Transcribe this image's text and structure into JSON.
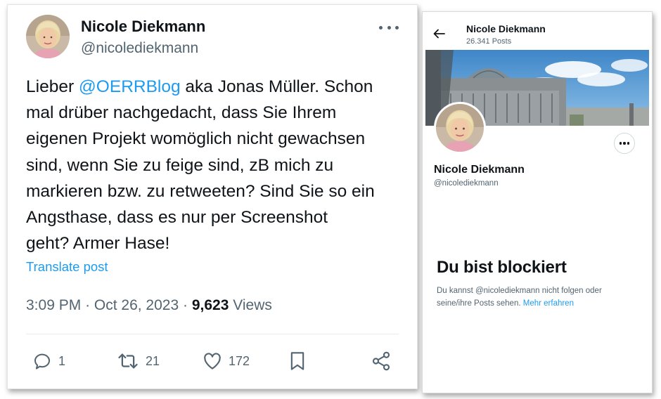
{
  "tweet": {
    "author_name": "Nicole Diekmann",
    "author_handle": "@nicolediekmann",
    "more_icon": "more-horizontal-icon",
    "text": {
      "line1_before": "Lieber ",
      "mention": "@OERRBlog",
      "line1_after": " aka Jonas Müller. Schon",
      "line2": "mal drüber nachgedacht, dass Sie Ihrem",
      "line3": "eigenen Projekt womöglich nicht gewachsen",
      "line4": "sind, wenn Sie zu feige sind, zB mich zu",
      "line5": "markieren bzw. zu retweeten? Sind Sie so ein",
      "line6": "Angsthase, dass es nur per Screenshot",
      "line7": "geht? Armer Hase!"
    },
    "translate_label": "Translate post",
    "time": "3:09 PM",
    "separator": "·",
    "date": "Oct 26, 2023",
    "views_count": "9,623",
    "views_label": "Views",
    "actions": {
      "replies": "1",
      "retweets": "21",
      "likes": "172"
    }
  },
  "profile": {
    "header_name": "Nicole Diekmann",
    "header_posts": "26.341 Posts",
    "name": "Nicole Diekmann",
    "handle": "@nicolediekmann",
    "blocked_title": "Du bist blockiert",
    "blocked_line1": "Du kannst @nicolediekmann nicht folgen oder",
    "blocked_line2_text": "seine/ihre Posts sehen.",
    "learn_more": "Mehr erfahren"
  },
  "colors": {
    "accent": "#1d9bf0",
    "text_primary": "#0f1419",
    "text_secondary": "#536471"
  }
}
